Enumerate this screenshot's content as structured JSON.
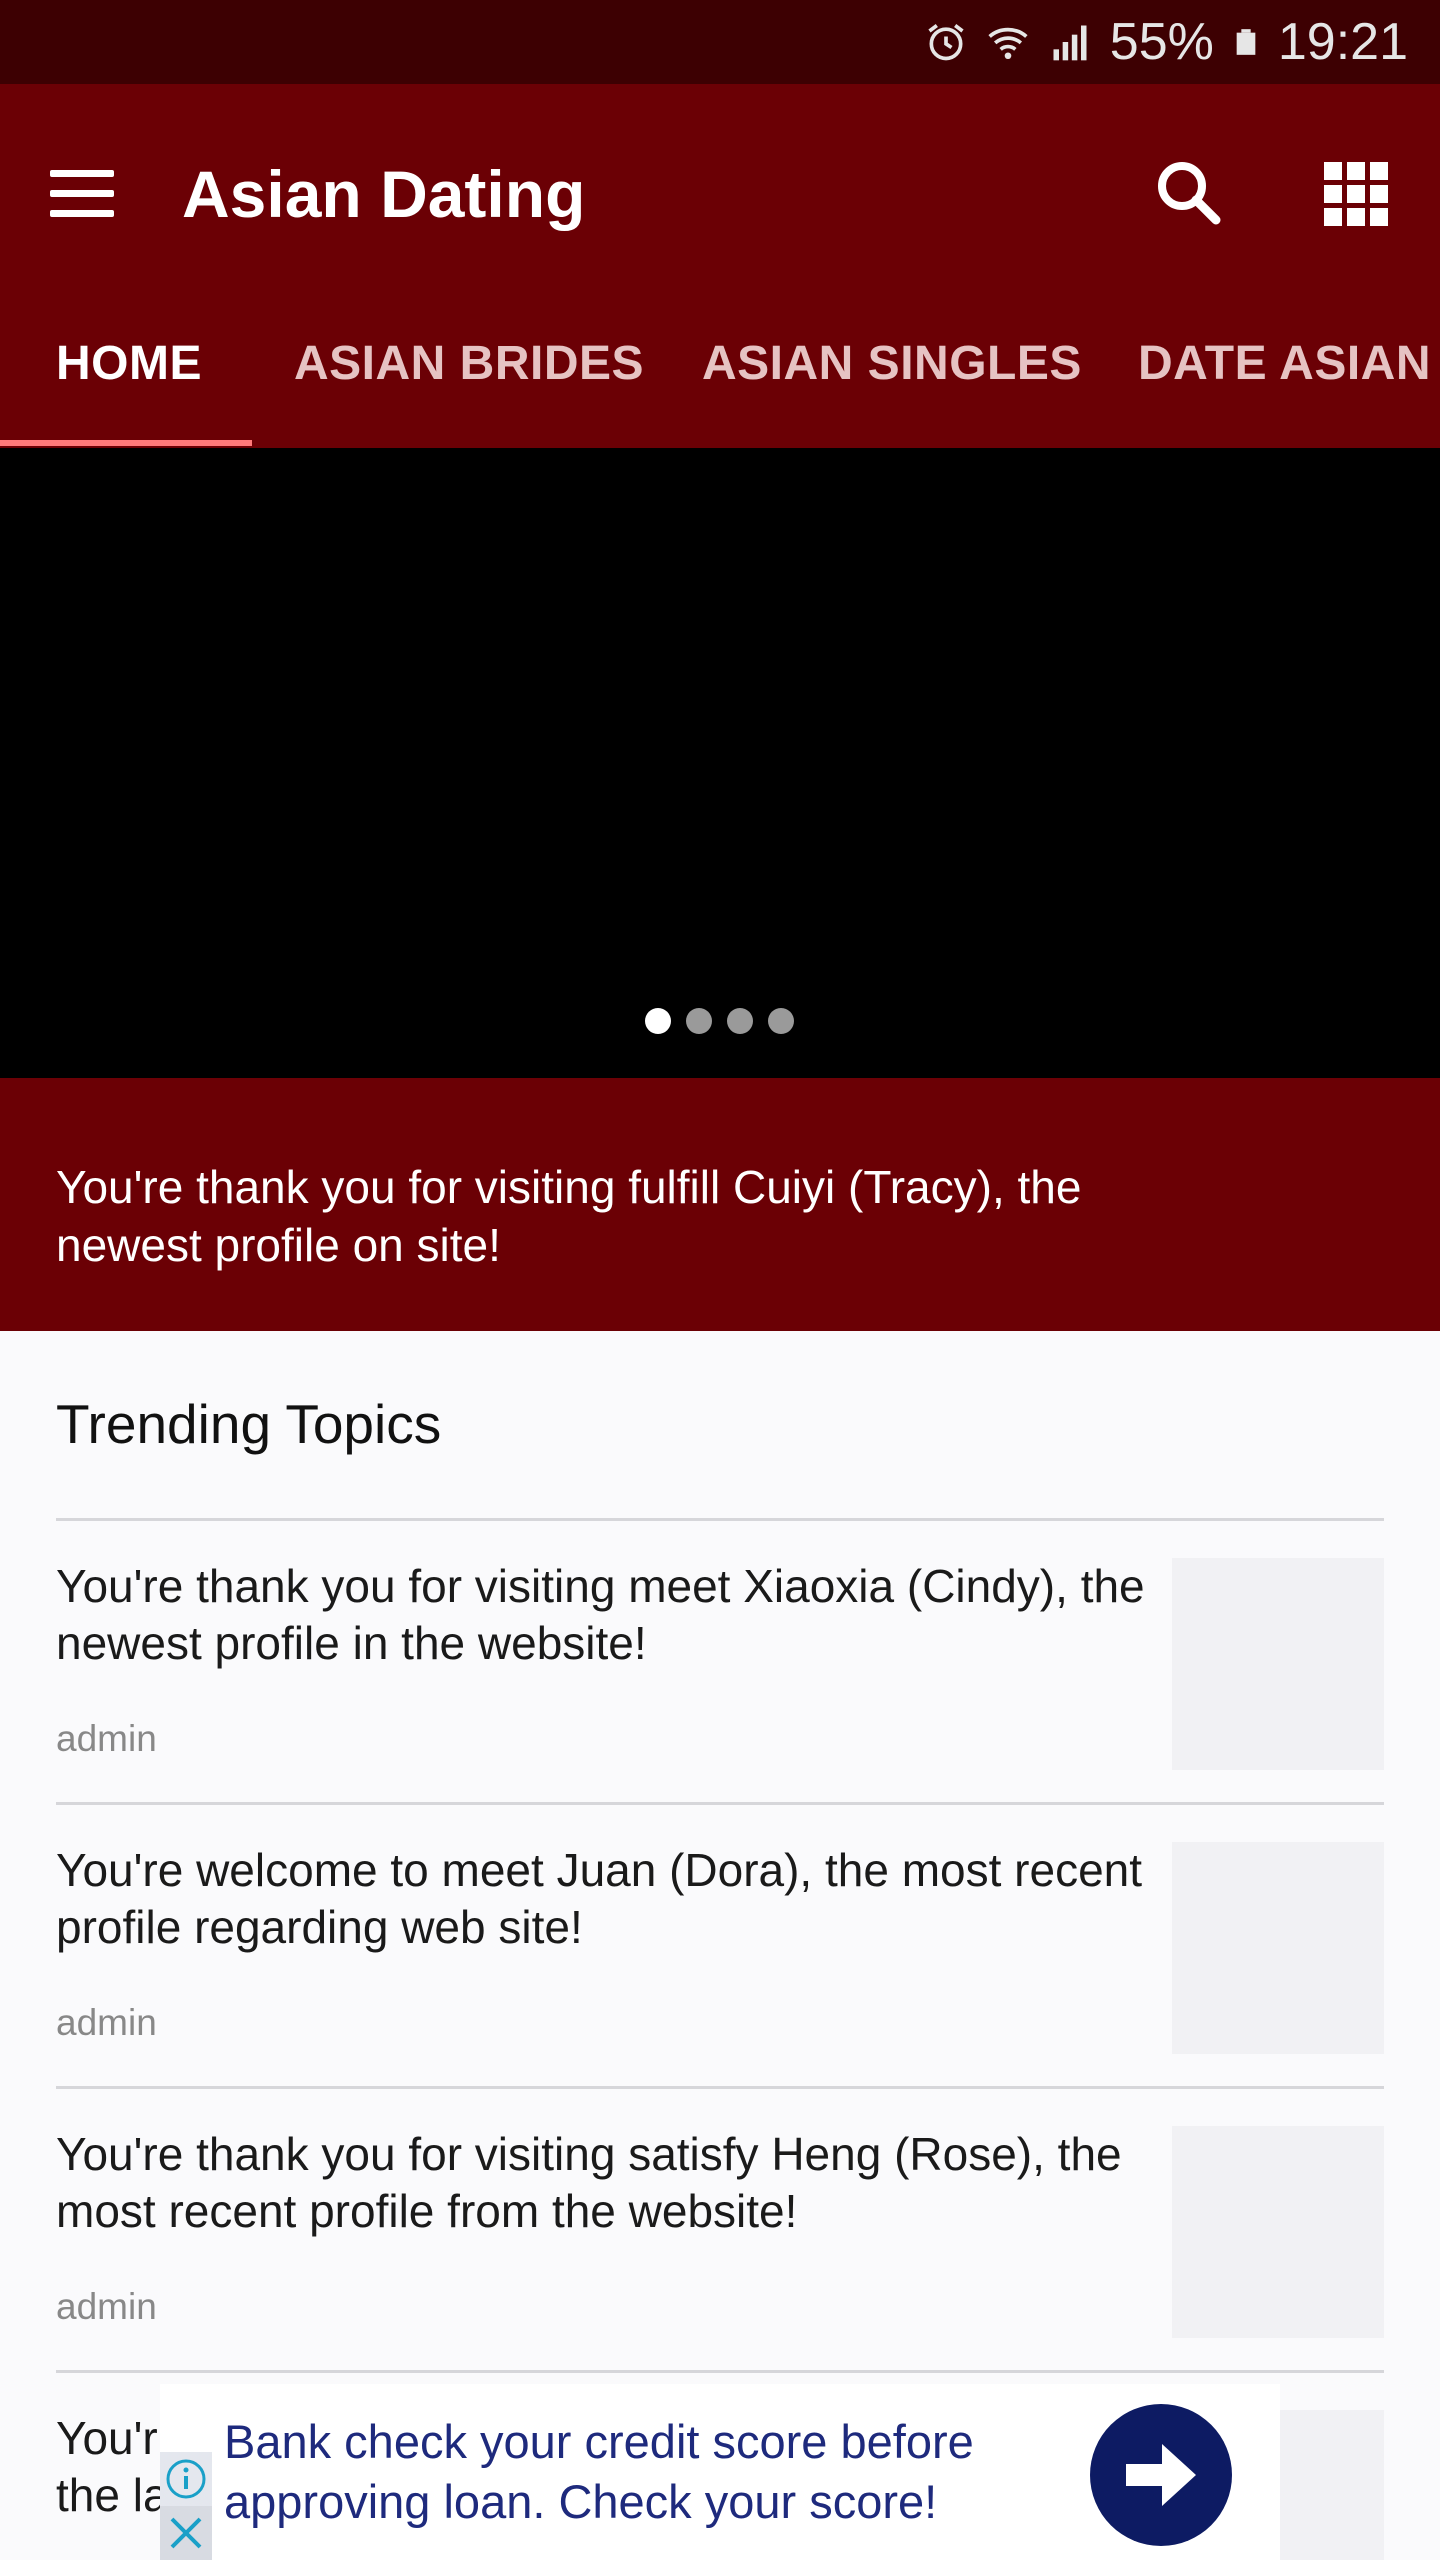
{
  "status_bar": {
    "battery": "55%",
    "time": "19:21",
    "icons": [
      "alarm-icon",
      "wifi-icon",
      "signal-icon",
      "battery-icon"
    ]
  },
  "app_bar": {
    "title": "Asian Dating",
    "icons": [
      "menu-icon",
      "search-icon",
      "apps-grid-icon"
    ]
  },
  "tabs": [
    {
      "label": "HOME",
      "active": true
    },
    {
      "label": "ASIAN BRIDES",
      "active": false
    },
    {
      "label": "ASIAN SINGLES",
      "active": false
    },
    {
      "label": "DATE ASIAN W",
      "active": false
    }
  ],
  "slider": {
    "page_count": 4,
    "current_page": 1
  },
  "banner": {
    "text": "You're thank you for visiting fulfill Cuiyi (Tracy), the newest profile on site!"
  },
  "trending": {
    "title": "Trending Topics",
    "items": [
      {
        "title": "You're thank you for visiting meet Xiaoxia (Cindy), the newest profile in the website!",
        "author": "admin"
      },
      {
        "title": "You're welcome to meet Juan (Dora), the most recent profile regarding web site!",
        "author": "admin"
      },
      {
        "title": "You're thank you for visiting satisfy Heng (Rose), the most recent profile from the website!",
        "author": "admin"
      },
      {
        "title": "You'r the la",
        "author": ""
      }
    ]
  },
  "ad": {
    "text": "Bank check your credit score before approving loan. Check your score!",
    "icons": [
      "info-icon",
      "close-icon",
      "arrow-right-icon"
    ]
  },
  "colors": {
    "status_bar": "#3d0002",
    "primary": "#6b0005",
    "tab_indicator": "#ff7a7a",
    "ad_text": "#1e2a7d",
    "ad_button": "#0d1b63"
  }
}
